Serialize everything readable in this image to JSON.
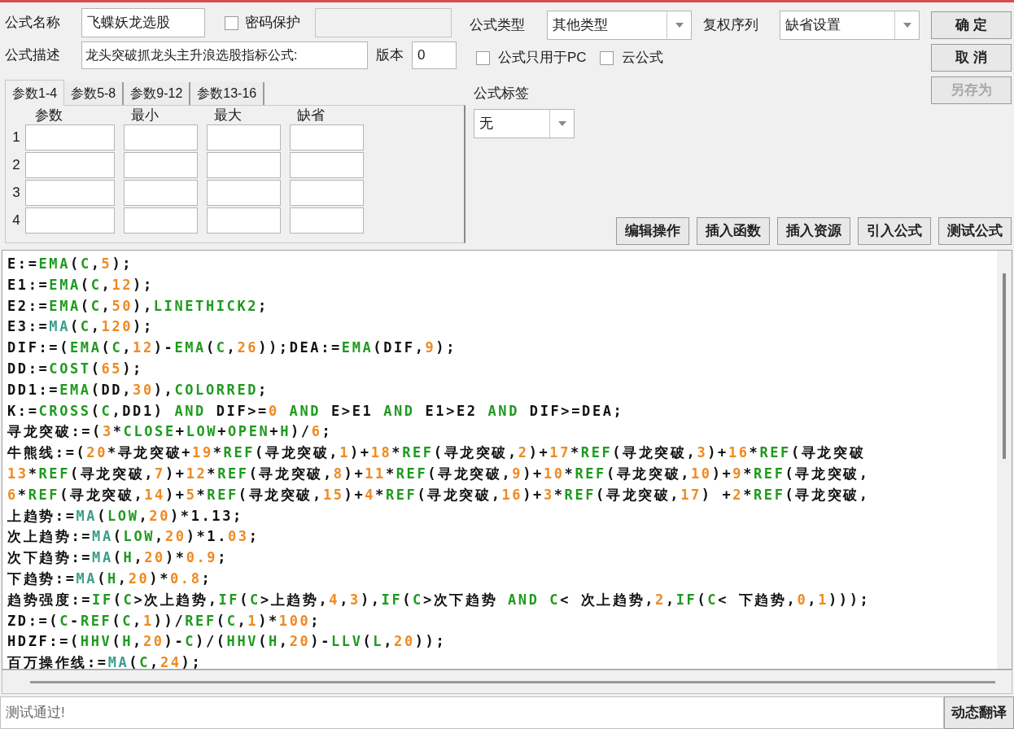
{
  "form": {
    "name_label": "公式名称",
    "name": "飞蝶妖龙选股",
    "password_protect": {
      "label": "密码保护",
      "checked": false
    },
    "desc_label": "公式描述",
    "desc": "龙头突破抓龙头主升浪选股指标公式:",
    "version_label": "版本",
    "version": "0"
  },
  "param_tabs": [
    {
      "label": "参数1-4",
      "selected": true
    },
    {
      "label": "参数5-8",
      "selected": false
    },
    {
      "label": "参数9-12",
      "selected": false
    },
    {
      "label": "参数13-16",
      "selected": false
    }
  ],
  "param_columns": [
    "参数",
    "最小",
    "最大",
    "缺省"
  ],
  "param_rows": [
    "1",
    "2",
    "3",
    "4"
  ],
  "formula_type": {
    "label": "公式类型",
    "value": "其他类型"
  },
  "rights_order": {
    "label": "复权序列",
    "value": "缺省设置"
  },
  "options": [
    {
      "label": "公式只用于PC",
      "checked": false
    },
    {
      "label": "云公式",
      "checked": false
    }
  ],
  "formula_tag": {
    "label": "公式标签",
    "value": "无"
  },
  "side_buttons": [
    {
      "label": "确 定",
      "disabled": false
    },
    {
      "label": "取 消",
      "disabled": false
    },
    {
      "label": "另存为",
      "disabled": true
    }
  ],
  "tool_buttons": [
    "编辑操作",
    "插入函数",
    "插入资源",
    "引入公式",
    "测试公式"
  ],
  "code_lines": [
    [
      {
        "kind": "plain",
        "text": "E:="
      },
      {
        "kind": "keyword",
        "text": "EMA"
      },
      {
        "kind": "plain",
        "text": "("
      },
      {
        "kind": "keyword",
        "text": "C"
      },
      {
        "kind": "plain",
        "text": ","
      },
      {
        "kind": "number",
        "text": "5"
      },
      {
        "kind": "plain",
        "text": ");"
      }
    ],
    [
      {
        "kind": "plain",
        "text": "E1:="
      },
      {
        "kind": "keyword",
        "text": "EMA"
      },
      {
        "kind": "plain",
        "text": "("
      },
      {
        "kind": "keyword",
        "text": "C"
      },
      {
        "kind": "plain",
        "text": ","
      },
      {
        "kind": "number",
        "text": "12"
      },
      {
        "kind": "plain",
        "text": ");"
      }
    ],
    [
      {
        "kind": "plain",
        "text": "E2:="
      },
      {
        "kind": "keyword",
        "text": "EMA"
      },
      {
        "kind": "plain",
        "text": "("
      },
      {
        "kind": "keyword",
        "text": "C"
      },
      {
        "kind": "plain",
        "text": ","
      },
      {
        "kind": "number",
        "text": "50"
      },
      {
        "kind": "plain",
        "text": "),"
      },
      {
        "kind": "keyword",
        "text": "LINETHICK2"
      },
      {
        "kind": "plain",
        "text": ";"
      }
    ],
    [
      {
        "kind": "plain",
        "text": "E3:="
      },
      {
        "kind": "builtin",
        "text": "MA"
      },
      {
        "kind": "plain",
        "text": "("
      },
      {
        "kind": "keyword",
        "text": "C"
      },
      {
        "kind": "plain",
        "text": ","
      },
      {
        "kind": "number",
        "text": "120"
      },
      {
        "kind": "plain",
        "text": ");"
      }
    ],
    [
      {
        "kind": "plain",
        "text": "DIF:=("
      },
      {
        "kind": "keyword",
        "text": "EMA"
      },
      {
        "kind": "plain",
        "text": "("
      },
      {
        "kind": "keyword",
        "text": "C"
      },
      {
        "kind": "plain",
        "text": ","
      },
      {
        "kind": "number",
        "text": "12"
      },
      {
        "kind": "plain",
        "text": ")-"
      },
      {
        "kind": "keyword",
        "text": "EMA"
      },
      {
        "kind": "plain",
        "text": "("
      },
      {
        "kind": "keyword",
        "text": "C"
      },
      {
        "kind": "plain",
        "text": ","
      },
      {
        "kind": "number",
        "text": "26"
      },
      {
        "kind": "plain",
        "text": "));DEA:="
      },
      {
        "kind": "keyword",
        "text": "EMA"
      },
      {
        "kind": "plain",
        "text": "(DIF,"
      },
      {
        "kind": "number",
        "text": "9"
      },
      {
        "kind": "plain",
        "text": ");"
      }
    ],
    [
      {
        "kind": "plain",
        "text": "DD:="
      },
      {
        "kind": "keyword",
        "text": "COST"
      },
      {
        "kind": "plain",
        "text": "("
      },
      {
        "kind": "number",
        "text": "65"
      },
      {
        "kind": "plain",
        "text": ");"
      }
    ],
    [
      {
        "kind": "plain",
        "text": "DD1:="
      },
      {
        "kind": "keyword",
        "text": "EMA"
      },
      {
        "kind": "plain",
        "text": "(DD,"
      },
      {
        "kind": "number",
        "text": "30"
      },
      {
        "kind": "plain",
        "text": "),"
      },
      {
        "kind": "keyword",
        "text": "COLORRED"
      },
      {
        "kind": "plain",
        "text": ";"
      }
    ],
    [
      {
        "kind": "plain",
        "text": "K:="
      },
      {
        "kind": "keyword",
        "text": "CROSS"
      },
      {
        "kind": "plain",
        "text": "("
      },
      {
        "kind": "keyword",
        "text": "C"
      },
      {
        "kind": "plain",
        "text": ",DD1) "
      },
      {
        "kind": "keyword",
        "text": "AND"
      },
      {
        "kind": "plain",
        "text": " DIF>="
      },
      {
        "kind": "number",
        "text": "0 "
      },
      {
        "kind": "keyword",
        "text": "AND"
      },
      {
        "kind": "plain",
        "text": " E>E1 "
      },
      {
        "kind": "keyword",
        "text": "AND"
      },
      {
        "kind": "plain",
        "text": " E1>E2 "
      },
      {
        "kind": "keyword",
        "text": "AND"
      },
      {
        "kind": "plain",
        "text": " DIF>=DEA;"
      }
    ],
    [
      {
        "kind": "plain",
        "text": "寻龙突破:=("
      },
      {
        "kind": "number",
        "text": "3"
      },
      {
        "kind": "plain",
        "text": "*"
      },
      {
        "kind": "keyword",
        "text": "CLOSE"
      },
      {
        "kind": "plain",
        "text": "+"
      },
      {
        "kind": "keyword",
        "text": "LOW"
      },
      {
        "kind": "plain",
        "text": "+"
      },
      {
        "kind": "keyword",
        "text": "OPEN"
      },
      {
        "kind": "plain",
        "text": "+"
      },
      {
        "kind": "keyword",
        "text": "H"
      },
      {
        "kind": "plain",
        "text": ")/"
      },
      {
        "kind": "number",
        "text": "6"
      },
      {
        "kind": "plain",
        "text": ";"
      }
    ],
    [
      {
        "kind": "plain",
        "text": "牛熊线:=("
      },
      {
        "kind": "number",
        "text": "20"
      },
      {
        "kind": "plain",
        "text": "*寻龙突破+"
      },
      {
        "kind": "number",
        "text": "19"
      },
      {
        "kind": "plain",
        "text": "*"
      },
      {
        "kind": "keyword",
        "text": "REF"
      },
      {
        "kind": "plain",
        "text": "(寻龙突破,"
      },
      {
        "kind": "number",
        "text": "1"
      },
      {
        "kind": "plain",
        "text": ")+"
      },
      {
        "kind": "number",
        "text": "18"
      },
      {
        "kind": "plain",
        "text": "*"
      },
      {
        "kind": "keyword",
        "text": "REF"
      },
      {
        "kind": "plain",
        "text": "(寻龙突破,"
      },
      {
        "kind": "number",
        "text": "2"
      },
      {
        "kind": "plain",
        "text": ")+"
      },
      {
        "kind": "number",
        "text": "17"
      },
      {
        "kind": "plain",
        "text": "*"
      },
      {
        "kind": "keyword",
        "text": "REF"
      },
      {
        "kind": "plain",
        "text": "(寻龙突破,"
      },
      {
        "kind": "number",
        "text": "3"
      },
      {
        "kind": "plain",
        "text": ")+"
      },
      {
        "kind": "number",
        "text": "16"
      },
      {
        "kind": "plain",
        "text": "*"
      },
      {
        "kind": "keyword",
        "text": "REF"
      },
      {
        "kind": "plain",
        "text": "(寻龙突破"
      }
    ],
    [
      {
        "kind": "number",
        "text": "13"
      },
      {
        "kind": "plain",
        "text": "*"
      },
      {
        "kind": "keyword",
        "text": "REF"
      },
      {
        "kind": "plain",
        "text": "(寻龙突破,"
      },
      {
        "kind": "number",
        "text": "7"
      },
      {
        "kind": "plain",
        "text": ")+"
      },
      {
        "kind": "number",
        "text": "12"
      },
      {
        "kind": "plain",
        "text": "*"
      },
      {
        "kind": "keyword",
        "text": "REF"
      },
      {
        "kind": "plain",
        "text": "(寻龙突破,"
      },
      {
        "kind": "number",
        "text": "8"
      },
      {
        "kind": "plain",
        "text": ")+"
      },
      {
        "kind": "number",
        "text": "11"
      },
      {
        "kind": "plain",
        "text": "*"
      },
      {
        "kind": "keyword",
        "text": "REF"
      },
      {
        "kind": "plain",
        "text": "(寻龙突破,"
      },
      {
        "kind": "number",
        "text": "9"
      },
      {
        "kind": "plain",
        "text": ")+"
      },
      {
        "kind": "number",
        "text": "10"
      },
      {
        "kind": "plain",
        "text": "*"
      },
      {
        "kind": "keyword",
        "text": "REF"
      },
      {
        "kind": "plain",
        "text": "(寻龙突破,"
      },
      {
        "kind": "number",
        "text": "10"
      },
      {
        "kind": "plain",
        "text": ")+"
      },
      {
        "kind": "number",
        "text": "9"
      },
      {
        "kind": "plain",
        "text": "*"
      },
      {
        "kind": "keyword",
        "text": "REF"
      },
      {
        "kind": "plain",
        "text": "(寻龙突破,"
      }
    ],
    [
      {
        "kind": "number",
        "text": "6"
      },
      {
        "kind": "plain",
        "text": "*"
      },
      {
        "kind": "keyword",
        "text": "REF"
      },
      {
        "kind": "plain",
        "text": "(寻龙突破,"
      },
      {
        "kind": "number",
        "text": "14"
      },
      {
        "kind": "plain",
        "text": ")+"
      },
      {
        "kind": "number",
        "text": "5"
      },
      {
        "kind": "plain",
        "text": "*"
      },
      {
        "kind": "keyword",
        "text": "REF"
      },
      {
        "kind": "plain",
        "text": "(寻龙突破,"
      },
      {
        "kind": "number",
        "text": "15"
      },
      {
        "kind": "plain",
        "text": ")+"
      },
      {
        "kind": "number",
        "text": "4"
      },
      {
        "kind": "plain",
        "text": "*"
      },
      {
        "kind": "keyword",
        "text": "REF"
      },
      {
        "kind": "plain",
        "text": "(寻龙突破,"
      },
      {
        "kind": "number",
        "text": "16"
      },
      {
        "kind": "plain",
        "text": ")+"
      },
      {
        "kind": "number",
        "text": "3"
      },
      {
        "kind": "plain",
        "text": "*"
      },
      {
        "kind": "keyword",
        "text": "REF"
      },
      {
        "kind": "plain",
        "text": "(寻龙突破,"
      },
      {
        "kind": "number",
        "text": "17"
      },
      {
        "kind": "plain",
        "text": ") +"
      },
      {
        "kind": "number",
        "text": "2"
      },
      {
        "kind": "plain",
        "text": "*"
      },
      {
        "kind": "keyword",
        "text": "REF"
      },
      {
        "kind": "plain",
        "text": "(寻龙突破,"
      }
    ],
    [
      {
        "kind": "plain",
        "text": "上趋势:="
      },
      {
        "kind": "builtin",
        "text": "MA"
      },
      {
        "kind": "plain",
        "text": "("
      },
      {
        "kind": "keyword",
        "text": "LOW"
      },
      {
        "kind": "plain",
        "text": ","
      },
      {
        "kind": "number",
        "text": "20"
      },
      {
        "kind": "plain",
        "text": ")*1.13;"
      }
    ],
    [
      {
        "kind": "plain",
        "text": "次上趋势:="
      },
      {
        "kind": "builtin",
        "text": "MA"
      },
      {
        "kind": "plain",
        "text": "("
      },
      {
        "kind": "keyword",
        "text": "LOW"
      },
      {
        "kind": "plain",
        "text": ","
      },
      {
        "kind": "number",
        "text": "20"
      },
      {
        "kind": "plain",
        "text": ")*1."
      },
      {
        "kind": "number",
        "text": "03"
      },
      {
        "kind": "plain",
        "text": ";"
      }
    ],
    [
      {
        "kind": "plain",
        "text": "次下趋势:="
      },
      {
        "kind": "builtin",
        "text": "MA"
      },
      {
        "kind": "plain",
        "text": "("
      },
      {
        "kind": "keyword",
        "text": "H"
      },
      {
        "kind": "plain",
        "text": ","
      },
      {
        "kind": "number",
        "text": "20"
      },
      {
        "kind": "plain",
        "text": ")*"
      },
      {
        "kind": "number",
        "text": "0.9"
      },
      {
        "kind": "plain",
        "text": ";"
      }
    ],
    [
      {
        "kind": "plain",
        "text": "下趋势:="
      },
      {
        "kind": "builtin",
        "text": "MA"
      },
      {
        "kind": "plain",
        "text": "("
      },
      {
        "kind": "keyword",
        "text": "H"
      },
      {
        "kind": "plain",
        "text": ","
      },
      {
        "kind": "number",
        "text": "20"
      },
      {
        "kind": "plain",
        "text": ")*"
      },
      {
        "kind": "number",
        "text": "0.8"
      },
      {
        "kind": "plain",
        "text": ";"
      }
    ],
    [
      {
        "kind": "plain",
        "text": "趋势强度:="
      },
      {
        "kind": "keyword",
        "text": "IF"
      },
      {
        "kind": "plain",
        "text": "("
      },
      {
        "kind": "keyword",
        "text": "C"
      },
      {
        "kind": "plain",
        "text": ">次上趋势,"
      },
      {
        "kind": "keyword",
        "text": "IF"
      },
      {
        "kind": "plain",
        "text": "("
      },
      {
        "kind": "keyword",
        "text": "C"
      },
      {
        "kind": "plain",
        "text": ">上趋势,"
      },
      {
        "kind": "number",
        "text": "4"
      },
      {
        "kind": "plain",
        "text": ","
      },
      {
        "kind": "number",
        "text": "3"
      },
      {
        "kind": "plain",
        "text": "),"
      },
      {
        "kind": "keyword",
        "text": "IF"
      },
      {
        "kind": "plain",
        "text": "("
      },
      {
        "kind": "keyword",
        "text": "C"
      },
      {
        "kind": "plain",
        "text": ">次下趋势 "
      },
      {
        "kind": "keyword",
        "text": "AND C"
      },
      {
        "kind": "plain",
        "text": "< 次上趋势,"
      },
      {
        "kind": "number",
        "text": "2"
      },
      {
        "kind": "plain",
        "text": ","
      },
      {
        "kind": "keyword",
        "text": "IF"
      },
      {
        "kind": "plain",
        "text": "("
      },
      {
        "kind": "keyword",
        "text": "C"
      },
      {
        "kind": "plain",
        "text": "< 下趋势,"
      },
      {
        "kind": "number",
        "text": "0"
      },
      {
        "kind": "plain",
        "text": ","
      },
      {
        "kind": "number",
        "text": "1"
      },
      {
        "kind": "plain",
        "text": ")));"
      }
    ],
    [
      {
        "kind": "plain",
        "text": "ZD:=("
      },
      {
        "kind": "keyword",
        "text": "C"
      },
      {
        "kind": "plain",
        "text": "-"
      },
      {
        "kind": "keyword",
        "text": "REF"
      },
      {
        "kind": "plain",
        "text": "("
      },
      {
        "kind": "keyword",
        "text": "C"
      },
      {
        "kind": "plain",
        "text": ","
      },
      {
        "kind": "number",
        "text": "1"
      },
      {
        "kind": "plain",
        "text": "))/"
      },
      {
        "kind": "keyword",
        "text": "REF"
      },
      {
        "kind": "plain",
        "text": "("
      },
      {
        "kind": "keyword",
        "text": "C"
      },
      {
        "kind": "plain",
        "text": ","
      },
      {
        "kind": "number",
        "text": "1"
      },
      {
        "kind": "plain",
        "text": ")*"
      },
      {
        "kind": "number",
        "text": "100"
      },
      {
        "kind": "plain",
        "text": ";"
      }
    ],
    [
      {
        "kind": "plain",
        "text": "HDZF:=("
      },
      {
        "kind": "keyword",
        "text": "HHV"
      },
      {
        "kind": "plain",
        "text": "("
      },
      {
        "kind": "keyword",
        "text": "H"
      },
      {
        "kind": "plain",
        "text": ","
      },
      {
        "kind": "number",
        "text": "20"
      },
      {
        "kind": "plain",
        "text": ")-"
      },
      {
        "kind": "keyword",
        "text": "C"
      },
      {
        "kind": "plain",
        "text": ")/("
      },
      {
        "kind": "keyword",
        "text": "HHV"
      },
      {
        "kind": "plain",
        "text": "("
      },
      {
        "kind": "keyword",
        "text": "H"
      },
      {
        "kind": "plain",
        "text": ","
      },
      {
        "kind": "number",
        "text": "20"
      },
      {
        "kind": "plain",
        "text": ")-"
      },
      {
        "kind": "keyword",
        "text": "LLV"
      },
      {
        "kind": "plain",
        "text": "("
      },
      {
        "kind": "keyword",
        "text": "L"
      },
      {
        "kind": "plain",
        "text": ","
      },
      {
        "kind": "number",
        "text": "20"
      },
      {
        "kind": "plain",
        "text": "));"
      }
    ],
    [
      {
        "kind": "plain",
        "text": "百万操作线:="
      },
      {
        "kind": "builtin",
        "text": "MA"
      },
      {
        "kind": "plain",
        "text": "("
      },
      {
        "kind": "keyword",
        "text": "C"
      },
      {
        "kind": "plain",
        "text": ","
      },
      {
        "kind": "number",
        "text": "24"
      },
      {
        "kind": "plain",
        "text": ");"
      }
    ]
  ],
  "status": {
    "message": "测试通过!",
    "button": "动态翻译"
  }
}
